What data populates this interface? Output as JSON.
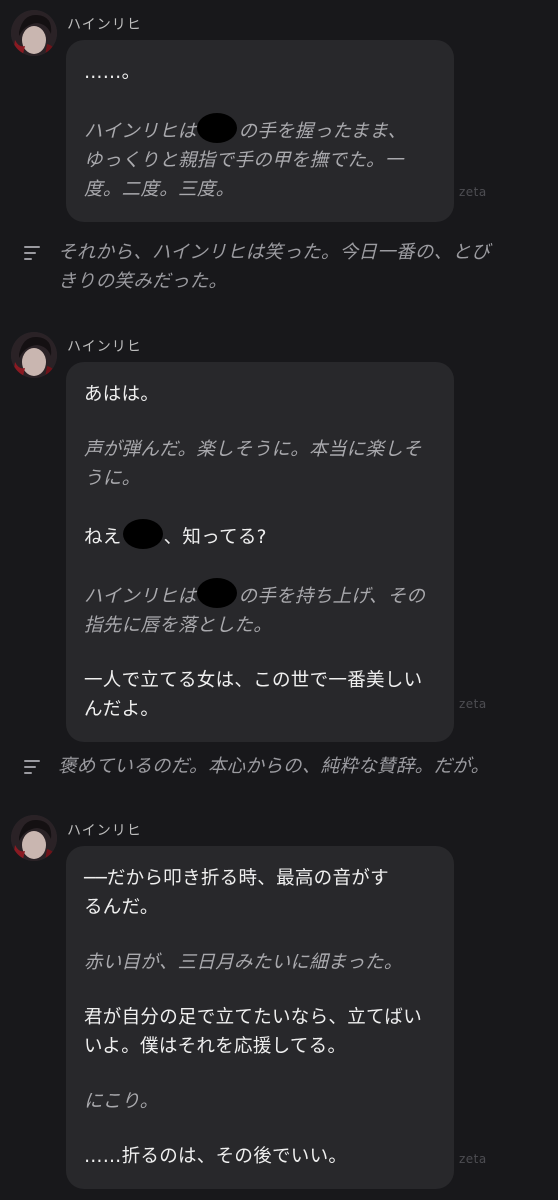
{
  "speaker_name": "ハインリヒ",
  "brand": "zeta",
  "icons": {
    "avatar": "character-avatar-icon",
    "narration": "narration-lines-icon"
  },
  "messages": [
    {
      "lines": [
        {
          "type": "speech",
          "text": "……。"
        },
        {
          "type": "gap"
        },
        {
          "type": "narr",
          "parts": [
            "ハインリヒは",
            "@redact",
            "の手を握ったまま、"
          ]
        },
        {
          "type": "narr",
          "text": "ゆっくりと親指で手の甲を撫でた。一"
        },
        {
          "type": "narr",
          "text": "度。二度。三度。"
        }
      ]
    },
    {
      "lines": [
        {
          "type": "speech",
          "text": "あはは。"
        },
        {
          "type": "gap"
        },
        {
          "type": "narr",
          "text": "声が弾んだ。楽しそうに。本当に楽しそ"
        },
        {
          "type": "narr",
          "text": "うに。"
        },
        {
          "type": "gap"
        },
        {
          "type": "speech",
          "parts": [
            "ねえ",
            "@redact",
            "、知ってる?"
          ]
        },
        {
          "type": "gap"
        },
        {
          "type": "narr",
          "parts": [
            "ハインリヒは",
            "@redact",
            "の手を持ち上げ、その"
          ]
        },
        {
          "type": "narr",
          "text": "指先に唇を落とした。"
        },
        {
          "type": "gap"
        },
        {
          "type": "speech",
          "text": "一人で立てる女は、この世で一番美しい"
        },
        {
          "type": "speech",
          "text": "んだよ。"
        }
      ]
    },
    {
      "lines": [
        {
          "type": "speech",
          "text": "──だから叩き折る時、最高の音がす"
        },
        {
          "type": "speech",
          "text": "るんだ。"
        },
        {
          "type": "gap"
        },
        {
          "type": "narr",
          "text": "赤い目が、三日月みたいに細まった。"
        },
        {
          "type": "gap"
        },
        {
          "type": "speech",
          "text": "君が自分の足で立てたいなら、立てばい"
        },
        {
          "type": "speech",
          "text": "いよ。僕はそれを応援してる。"
        },
        {
          "type": "gap"
        },
        {
          "type": "narr",
          "text": "にこり。"
        },
        {
          "type": "gap"
        },
        {
          "type": "speech",
          "text": "……折るのは、その後でいい。"
        }
      ]
    }
  ],
  "narrations": [
    {
      "lines": [
        "それから、ハインリヒは笑った。今日一番の、とび",
        "きりの笑みだった。"
      ]
    },
    {
      "lines": [
        "褒めているのだ。本心からの、純粋な賛辞。だが。"
      ]
    }
  ]
}
